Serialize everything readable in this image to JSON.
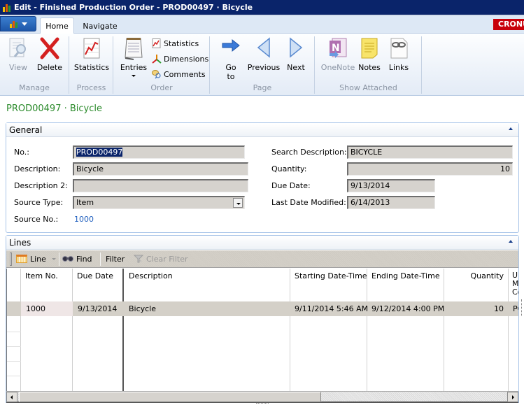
{
  "window": {
    "title": "Edit - Finished Production Order - PROD00497 · Bicycle",
    "company_badge": "CRONUS"
  },
  "tabs": [
    {
      "label": "Home",
      "active": true
    },
    {
      "label": "Navigate",
      "active": false
    }
  ],
  "ribbon": {
    "groups": {
      "manage": "Manage",
      "process": "Process",
      "order": "Order",
      "page": "Page",
      "show_attached": "Show Attached"
    },
    "buttons": {
      "view": "View",
      "delete": "Delete",
      "statistics_process": "Statistics",
      "entries": "Entries",
      "statistics_order": "Statistics",
      "dimensions": "Dimensions",
      "comments": "Comments",
      "goto_line1": "Go",
      "goto_line2": "to",
      "previous": "Previous",
      "next": "Next",
      "onenote": "OneNote",
      "notes": "Notes",
      "links": "Links"
    }
  },
  "page": {
    "title": "PROD00497 · Bicycle"
  },
  "general": {
    "header": "General",
    "fields": {
      "no_label": "No.:",
      "no_value": "PROD00497",
      "description_label": "Description:",
      "description_value": "Bicycle",
      "description2_label": "Description 2:",
      "description2_value": "",
      "source_type_label": "Source Type:",
      "source_type_value": "Item",
      "source_no_label": "Source No.:",
      "source_no_value": "1000",
      "search_description_label": "Search Description:",
      "search_description_value": "BICYCLE",
      "quantity_label": "Quantity:",
      "quantity_value": "10",
      "due_date_label": "Due Date:",
      "due_date_value": "9/13/2014",
      "last_date_modified_label": "Last Date Modified:",
      "last_date_modified_value": "6/14/2013"
    }
  },
  "lines": {
    "header": "Lines",
    "toolbar": {
      "line": "Line",
      "find": "Find",
      "filter": "Filter",
      "clear_filter": "Clear Filter"
    },
    "columns": [
      "Item No.",
      "Due Date",
      "Description",
      "Starting Date-Time",
      "Ending Date-Time",
      "Quantity",
      "Unit of Measure Code"
    ],
    "columns_visible_text": {
      "unit_line1": "Ur",
      "unit_line2": "Me",
      "unit_line3": "Co"
    },
    "rows": [
      {
        "item_no": "1000",
        "due_date": "9/13/2014",
        "description": "Bicycle",
        "starting_date_time": "9/11/2014 5:46 AM",
        "ending_date_time": "9/12/2014 4:00 PM",
        "quantity": "10",
        "unit_partial": "PC"
      }
    ]
  },
  "colors": {
    "titlebar": "#0a246a",
    "page_title": "#2a8a2a",
    "link": "#1f5fbf",
    "badge": "#c8000a"
  }
}
